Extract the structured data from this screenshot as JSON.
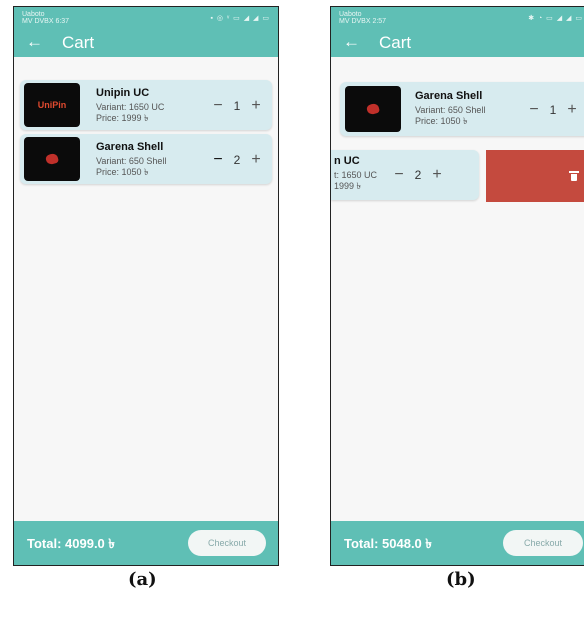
{
  "panel_a": {
    "status": {
      "left": "Uaboto\nMV DVBX 6:37",
      "right": "▪ ◎ ᵛ ▭ ◢ ◢ ▭"
    },
    "appbar": {
      "back_icon": "←",
      "title": "Cart"
    },
    "items": [
      {
        "name": "Unipin UC",
        "variant": "Variant: 1650 UC",
        "price": "Price: 1999 ৳",
        "qty": "1",
        "logo": "UniPin"
      },
      {
        "name": "Garena Shell",
        "variant": "Variant: 650 Shell",
        "price": "Price: 1050 ৳",
        "qty": "2"
      }
    ],
    "total": "Total: 4099.0 ৳",
    "checkout_label": "Checkout",
    "caption": "(a)"
  },
  "panel_b": {
    "status": {
      "left": "Uaboto\nMV DVBX 2:57",
      "right": "✱ ◔ ▭ ◢ ◢ ▭"
    },
    "appbar": {
      "back_icon": "←",
      "title": "Cart"
    },
    "items": [
      {
        "name": "Garena Shell",
        "variant": "Variant: 650 Shell",
        "price": "Price: 1050 ৳",
        "qty": "1"
      },
      {
        "name": "n UC",
        "variant": "t: 1650 UC",
        "price": "1999 ৳",
        "qty": "2"
      }
    ],
    "total": "Total: 5048.0 ৳",
    "checkout_label": "Checkout",
    "caption": "(b)"
  },
  "icons": {
    "minus": "−",
    "plus": "+",
    "delete": "trash-icon"
  },
  "colors": {
    "primary": "#5fbfb5",
    "card": "#d7ebef",
    "delete": "#c44a3e"
  }
}
